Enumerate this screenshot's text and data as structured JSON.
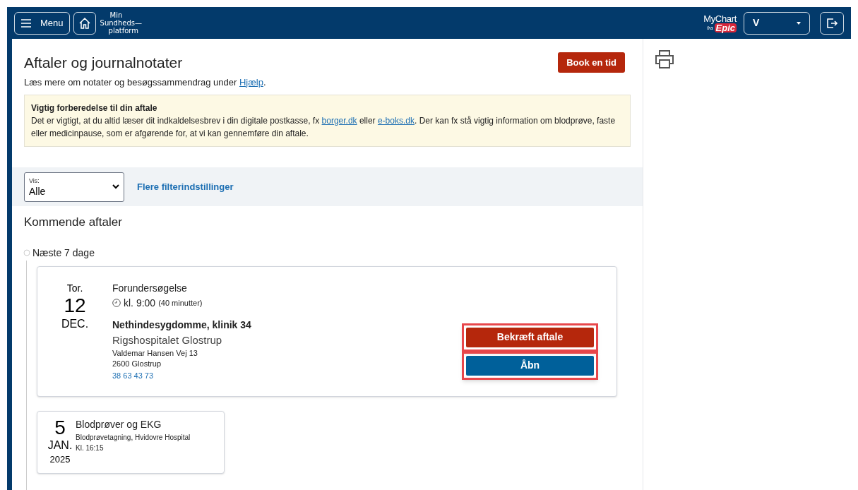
{
  "header": {
    "menu_button": "Menu",
    "logo_lines": [
      "Min",
      "Sundheds—",
      "platform"
    ],
    "brand": {
      "top": "MyChart",
      "small": "fra",
      "bottom": "Epic"
    },
    "account_select": "V"
  },
  "page": {
    "title": "Aftaler og journalnotater",
    "book_button": "Book en tid",
    "help_text": "Læs mere om notater og besøgssammendrag under ",
    "help_link": "Hjælp",
    "help_end": "."
  },
  "notice": {
    "title": "Vigtig forberedelse til din aftale",
    "parts": [
      {
        "kind": "text",
        "text": "Det er vigtigt, at du altid læser dit indkaldelsesbrev i din digitale postkasse, fx "
      },
      {
        "kind": "link",
        "text": "borger.dk"
      },
      {
        "kind": "text",
        "text": " eller "
      },
      {
        "kind": "link",
        "text": "e-boks.dk"
      },
      {
        "kind": "text",
        "text": ". Der kan fx stå vigtig information om blodprøve, faste eller medicinpause, som er afgørende for, at vi kan gennemføre din aftale."
      }
    ]
  },
  "filter": {
    "label": "Vis:",
    "value": "Alle",
    "more_link": "Flere filterindstillinger"
  },
  "upcoming": {
    "heading": "Kommende aftaler",
    "group": "Næste 7 dage",
    "appointments": [
      {
        "kind": "detailed",
        "weekday": "Tor.",
        "day": "12",
        "month": "DEC.",
        "title": "Forundersøgelse",
        "time": "kl. 9:00",
        "duration": "(40 minutter)",
        "department": "Nethindesygdomme, klinik 34",
        "location": "Rigshospitalet Glostrup",
        "address": [
          "Valdemar Hansen Vej 13",
          "2600 Glostrup"
        ],
        "phone": "38 63 43 73",
        "buttons": [
          {
            "kind": "confirm",
            "label": "Bekræft aftale",
            "highlighted": true
          },
          {
            "kind": "open",
            "label": "Åbn",
            "highlighted": true
          }
        ]
      },
      {
        "kind": "compact",
        "day": "5",
        "month": "JAN.",
        "year": "2025",
        "title": "Blodprøver og EKG",
        "subtitle": "Blodprøvetagning, Hvidovre Hospital",
        "time": "Kl. 16:15"
      }
    ]
  }
}
